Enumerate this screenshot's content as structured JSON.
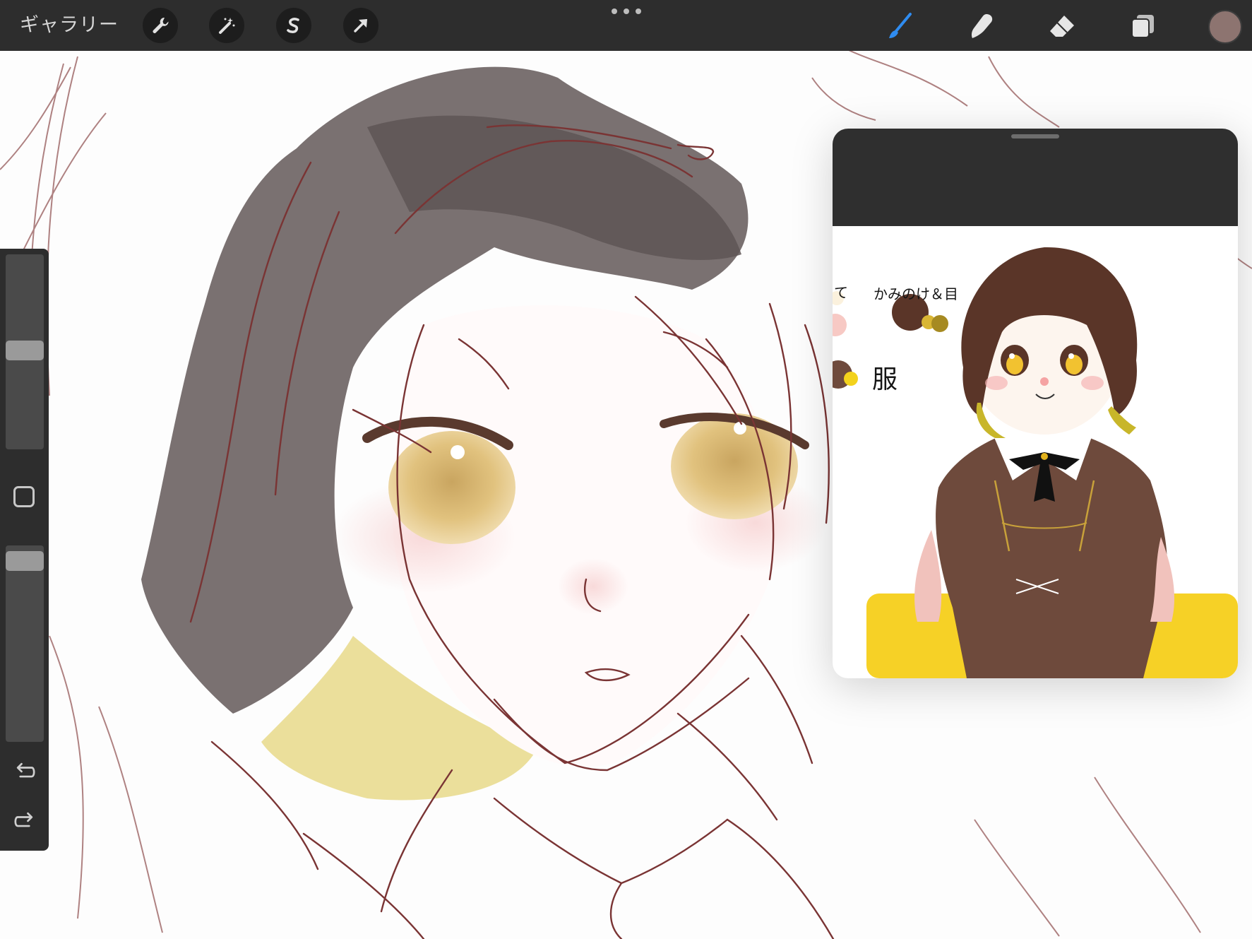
{
  "toolbar": {
    "gallery_label": "ギャラリー",
    "left_tools": [
      {
        "name": "actions",
        "icon": "wrench-icon"
      },
      {
        "name": "adjustments",
        "icon": "magic-wand-icon"
      },
      {
        "name": "selection",
        "icon": "selection-s-icon"
      },
      {
        "name": "transform",
        "icon": "arrow-cursor-icon"
      }
    ],
    "more_icon": "ellipsis-icon",
    "right_tools": [
      {
        "name": "brush",
        "icon": "brush-icon",
        "active": true
      },
      {
        "name": "smudge",
        "icon": "smudge-finger-icon"
      },
      {
        "name": "eraser",
        "icon": "eraser-icon"
      },
      {
        "name": "layers",
        "icon": "layers-icon"
      }
    ],
    "current_color": "#8d7470",
    "active_color": "#2f8cf0"
  },
  "sidebar": {
    "brush_size_level": 0.51,
    "opacity_level": 0.97,
    "modify_icon": "square-modify-icon",
    "undo_icon": "undo-icon",
    "redo_icon": "redo-icon"
  },
  "reference": {
    "labels": {
      "partial": "て",
      "hair_eyes": "かみのけ＆目",
      "clothes": "服"
    },
    "swatches": {
      "hair": "#5a3528",
      "eyes": "#d9b634",
      "skin": "#f7c9c4",
      "clothes": "#6e4a3c",
      "yellow_bg": "#f6d126"
    }
  }
}
